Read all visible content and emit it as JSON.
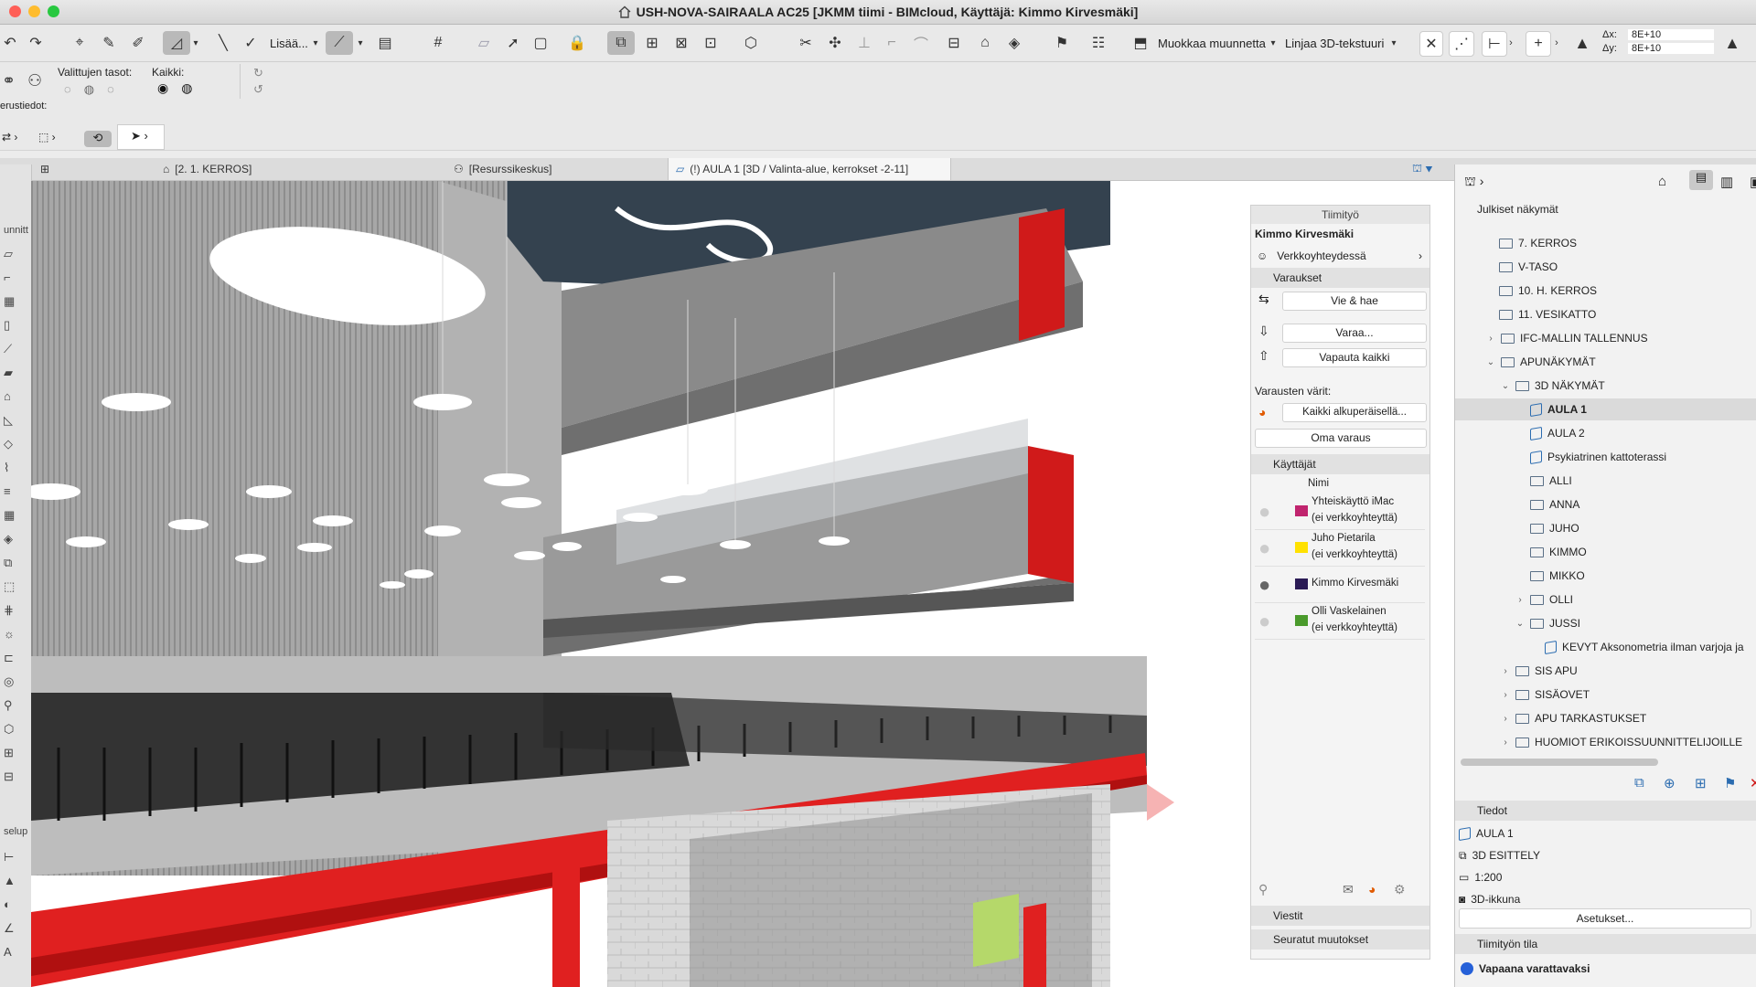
{
  "titlebar": {
    "title": "USH-NOVA-SAIRAALA AC25 [JKMM tiimi - BIMcloud, Käyttäjä: Kimmo Kirvesmäki]",
    "home_icon": "house-icon",
    "traffic_colors": [
      "#ff5f57",
      "#febc2e",
      "#28c840"
    ]
  },
  "toolbar": {
    "add_label": "Lisää...",
    "modify_label": "Muokkaa muunnetta",
    "align_label": "Linjaa 3D-tekstuuri",
    "dx_label": "Δx:",
    "dx_value": "8E+10",
    "dy_label": "Δy:",
    "dy_value": "8E+10"
  },
  "infobox": {
    "selected_layers": "Valittujen tasot:",
    "all_label": "Kaikki:",
    "basic_info": "erustiedot:"
  },
  "tabs": [
    {
      "label": "[2. 1. KERROS]",
      "icon": "floorplan-icon"
    },
    {
      "label": "[Resurssikeskus]",
      "icon": "resource-icon"
    },
    {
      "label": "(!) AULA 1 [3D / Valinta-alue, kerrokset -2-11]",
      "icon": "3d-view-icon"
    }
  ],
  "toolbox": {
    "label1": "unnitt",
    "label2": "selup"
  },
  "teamwork": {
    "title": "Tiimityö",
    "user": "Kimmo Kirvesmäki",
    "status": "Verkkoyhteydessä",
    "reservations_header": "Varaukset",
    "send_receive": "Vie & hae",
    "reserve": "Varaa...",
    "release_all": "Vapauta kaikki",
    "colors_label": "Varausten värit:",
    "colors_value": "Kaikki alkuperäisellä...",
    "own_reservation": "Oma varaus",
    "users_header": "Käyttäjät",
    "name_col": "Nimi",
    "users": [
      {
        "name": "Yhteiskäyttö iMac",
        "sub": "(ei verkkoyhteyttä)",
        "color": "#c0246e"
      },
      {
        "name": "Juho Pietarila",
        "sub": "(ei verkkoyhteyttä)",
        "color": "#ffe100"
      },
      {
        "name": "Kimmo Kirvesmäki",
        "sub": "",
        "color": "#2a1a55"
      },
      {
        "name": "Olli Vaskelainen",
        "sub": "(ei verkkoyhteyttä)",
        "color": "#4a9a2c"
      }
    ],
    "messages": "Viestit",
    "tracked_changes": "Seuratut muutokset"
  },
  "navigator": {
    "header": "Julkiset näkymät",
    "items": [
      {
        "label": "7. KERROS",
        "type": "plan"
      },
      {
        "label": "V-TASO",
        "type": "plan"
      },
      {
        "label": "10. H. KERROS",
        "type": "plan"
      },
      {
        "label": "11. VESIKATTO",
        "type": "plan"
      },
      {
        "label": "IFC-MALLIN TALLENNUS",
        "type": "folder"
      },
      {
        "label": "APUNÄKYMÄT",
        "type": "folder"
      },
      {
        "label": "3D NÄKYMÄT",
        "type": "folder"
      },
      {
        "label": "AULA 1",
        "type": "view"
      },
      {
        "label": "AULA 2",
        "type": "view"
      },
      {
        "label": "Psykiatrinen kattoterassi",
        "type": "view"
      },
      {
        "label": "ALLI",
        "type": "folder"
      },
      {
        "label": "ANNA",
        "type": "folder"
      },
      {
        "label": "JUHO",
        "type": "folder"
      },
      {
        "label": "KIMMO",
        "type": "folder"
      },
      {
        "label": "MIKKO",
        "type": "folder"
      },
      {
        "label": "OLLI",
        "type": "folder"
      },
      {
        "label": "JUSSI",
        "type": "folder"
      },
      {
        "label": "KEVYT Aksonometria ilman varjoja ja",
        "type": "view"
      },
      {
        "label": "SIS APU",
        "type": "folder"
      },
      {
        "label": "SISÄOVET",
        "type": "folder"
      },
      {
        "label": "APU TARKASTUKSET",
        "type": "folder"
      },
      {
        "label": "HUOMIOT ERIKOISSUUNNITTELIJOILLE",
        "type": "folder"
      }
    ],
    "details_header": "Tiedot",
    "details": {
      "name": "AULA 1",
      "type": "3D ESITTELY",
      "scale": "1:200",
      "window": "3D-ikkuna"
    },
    "settings_button": "Asetukset...",
    "teamwork_status_header": "Tiimityön tila",
    "teamwork_status_value": "Vapaana varattavaksi"
  }
}
